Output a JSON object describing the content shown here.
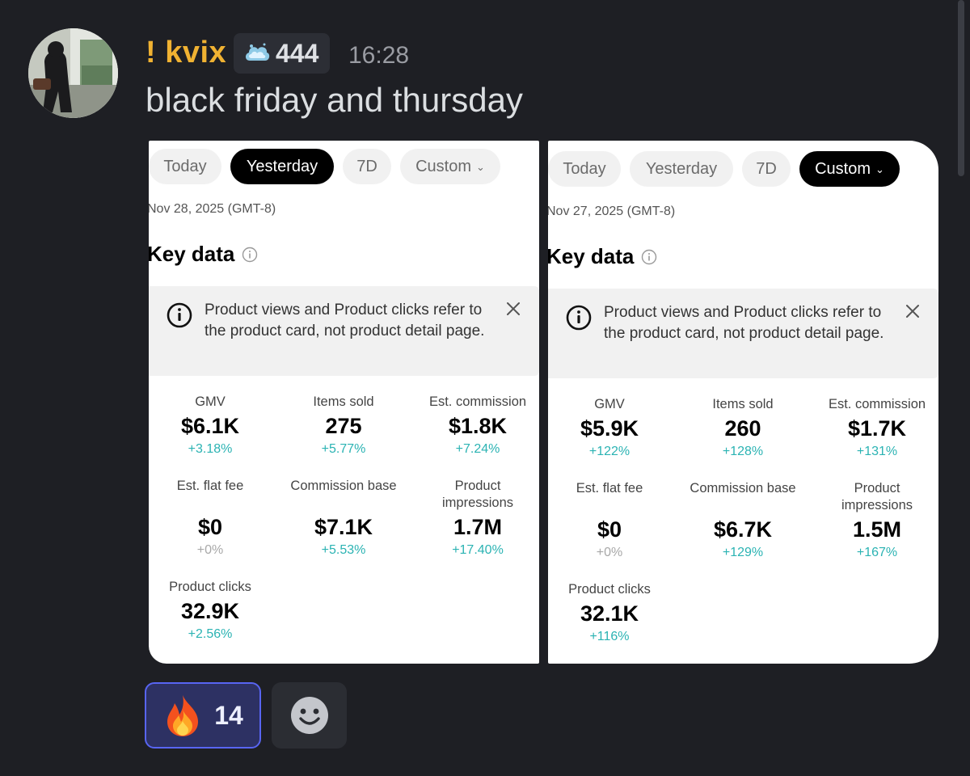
{
  "message": {
    "author": "! kvix",
    "badge_count": "444",
    "timestamp": "16:28",
    "text": "black friday and thursday"
  },
  "screenshots": [
    {
      "tabs": [
        {
          "label": "Today",
          "active": false
        },
        {
          "label": "Yesterday",
          "active": true
        },
        {
          "label": "7D",
          "active": false
        },
        {
          "label": "Custom",
          "active": false
        }
      ],
      "date": "Nov 28, 2025 (GMT-8)",
      "key_data_title": "Key data",
      "banner_text": "Product views and Product clicks refer to the product card, not product detail page.",
      "metrics": {
        "gmv": {
          "label": "GMV",
          "value": "$6.1K",
          "change": "+3.18%"
        },
        "items_sold": {
          "label": "Items sold",
          "value": "275",
          "change": "+5.77%"
        },
        "est_commission": {
          "label": "Est. commission",
          "value": "$1.8K",
          "change": "+7.24%"
        },
        "est_flat_fee": {
          "label": "Est. flat fee",
          "value": "$0",
          "change": "+0%"
        },
        "commission_base": {
          "label": "Commission base",
          "value": "$7.1K",
          "change": "+5.53%"
        },
        "product_impressions": {
          "label": "Product impressions",
          "value": "1.7M",
          "change": "+17.40%"
        },
        "product_clicks": {
          "label": "Product clicks",
          "value": "32.9K",
          "change": "+2.56%"
        }
      }
    },
    {
      "tabs": [
        {
          "label": "Today",
          "active": false
        },
        {
          "label": "Yesterday",
          "active": false
        },
        {
          "label": "7D",
          "active": false
        },
        {
          "label": "Custom",
          "active": true
        }
      ],
      "date": "Nov 27, 2025 (GMT-8)",
      "key_data_title": "Key data",
      "banner_text": "Product views and Product clicks refer to the product card, not product detail page.",
      "metrics": {
        "gmv": {
          "label": "GMV",
          "value": "$5.9K",
          "change": "+122%"
        },
        "items_sold": {
          "label": "Items sold",
          "value": "260",
          "change": "+128%"
        },
        "est_commission": {
          "label": "Est. commission",
          "value": "$1.7K",
          "change": "+131%"
        },
        "est_flat_fee": {
          "label": "Est. flat fee",
          "value": "$0",
          "change": "+0%"
        },
        "commission_base": {
          "label": "Commission base",
          "value": "$6.7K",
          "change": "+129%"
        },
        "product_impressions": {
          "label": "Product impressions",
          "value": "1.5M",
          "change": "+167%"
        },
        "product_clicks": {
          "label": "Product clicks",
          "value": "32.1K",
          "change": "+116%"
        }
      }
    }
  ],
  "reactions": [
    {
      "emoji": "fire-icon",
      "count": "14",
      "selected": true
    }
  ],
  "colors": {
    "background": "#1e1f24",
    "username": "#f0b232",
    "reaction_border": "#5865f2",
    "positive_change": "#2bb3b3"
  }
}
